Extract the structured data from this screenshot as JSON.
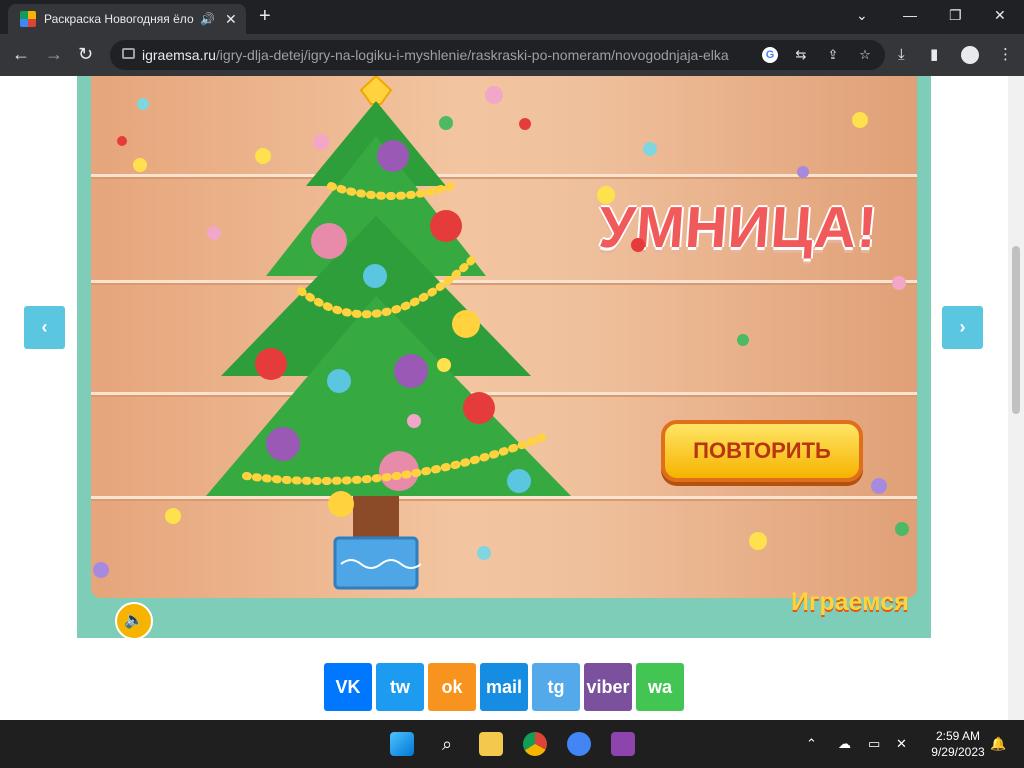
{
  "browser": {
    "tab_title": "Раскраска Новогодняя ёло",
    "tab_audio_icon": "speaker-icon",
    "new_tab_label": "+",
    "url_host": "igraemsa.ru",
    "url_path": "/igry-dlja-detej/igry-na-logiku-i-myshlenie/raskraski-po-nomeram/novogodnjaja-elka"
  },
  "game": {
    "banner_text": "УМНИЦА!",
    "repeat_button": "ПОВТОРИТЬ",
    "logo_text": "Играемся",
    "prev_arrow": "‹",
    "next_arrow": "›"
  },
  "share": {
    "items": [
      {
        "label": "VK",
        "color": "#0077ff",
        "icon": "vk-icon"
      },
      {
        "label": "tw",
        "color": "#1d9bf0",
        "icon": "twitter-icon"
      },
      {
        "label": "ok",
        "color": "#f7931e",
        "icon": "odnoklassniki-icon"
      },
      {
        "label": "mail",
        "color": "#168de2",
        "icon": "mail-ru-icon"
      },
      {
        "label": "tg",
        "color": "#54a9eb",
        "icon": "telegram-icon"
      },
      {
        "label": "viber",
        "color": "#7b519d",
        "icon": "viber-icon"
      },
      {
        "label": "wa",
        "color": "#43c553",
        "icon": "whatsapp-icon"
      }
    ]
  },
  "taskbar": {
    "time": "2:59 AM",
    "date": "9/29/2023"
  }
}
